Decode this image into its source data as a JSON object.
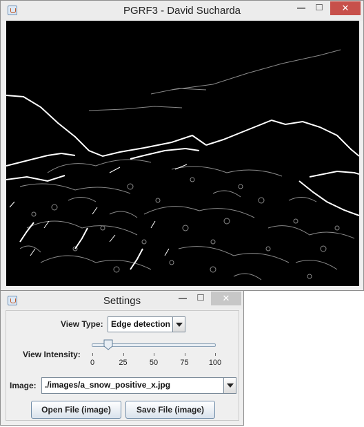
{
  "main_window": {
    "title": "PGRF3 - David Sucharda",
    "controls": {
      "minimize": "—",
      "maximize": "□",
      "close": "✕"
    },
    "icon": "java-icon"
  },
  "settings_window": {
    "title": "Settings",
    "controls": {
      "minimize": "—",
      "maximize": "□",
      "close": "✕"
    },
    "icon": "java-icon",
    "view_type": {
      "label": "View Type:",
      "selected": "Edge detection"
    },
    "view_intensity": {
      "label": "View Intensity:",
      "value": 13,
      "min": 0,
      "max": 100,
      "tick_labels": [
        "0",
        "25",
        "50",
        "75",
        "100"
      ]
    },
    "image": {
      "label": "Image:",
      "selected": "./images/a_snow_positive_x.jpg"
    },
    "buttons": {
      "open": "Open File (image)",
      "save": "Save File (image)"
    }
  },
  "colors": {
    "close_red": "#c7504b",
    "canvas_bg": "#000000",
    "edge_white": "#ffffff",
    "edge_gray": "#8a8a8a"
  }
}
